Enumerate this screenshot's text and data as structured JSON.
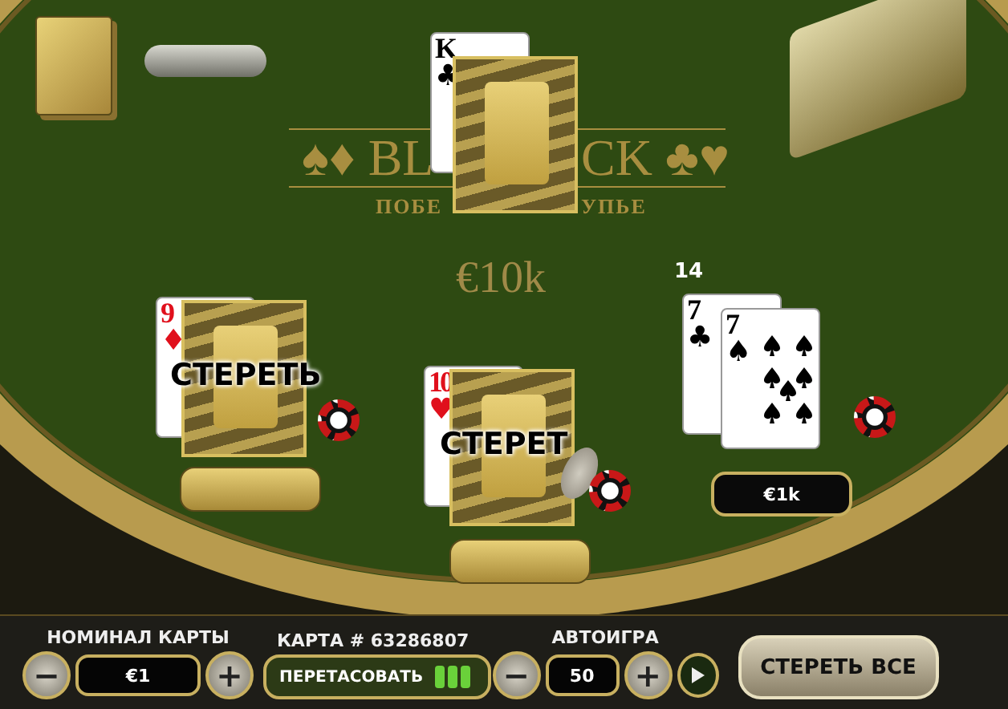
{
  "logo": {
    "left": "♠♦ BL",
    "right": "CK ♣♥",
    "sub_left": "ПОБЕ",
    "sub_right": "УПЬЕ"
  },
  "dealer": {
    "cards": [
      {
        "rank": "K",
        "suit": "♣",
        "color": "#000000"
      }
    ],
    "face_down": true
  },
  "pot": "€10k",
  "hands": [
    {
      "cards": [
        {
          "rank": "9",
          "suit": "♦",
          "color": "#e0101c"
        }
      ],
      "face_down": true,
      "label": "СТЕРЕТЬ",
      "coin": false
    },
    {
      "cards": [
        {
          "rank": "10",
          "suit": "♥",
          "color": "#e0101c"
        }
      ],
      "face_down": true,
      "label": "СТЕРЕТ",
      "coin": true
    },
    {
      "score": "14",
      "cards": [
        {
          "rank": "7",
          "suit": "♣",
          "color": "#000000"
        },
        {
          "rank": "7",
          "suit": "♠",
          "color": "#000000",
          "pips": true
        }
      ],
      "face_down": false,
      "bet": "€1k",
      "coin": false
    }
  ],
  "controls": {
    "card_value": {
      "label": "НОМИНАЛ КАРТЫ",
      "minus": "−",
      "value": "€1",
      "plus": "+"
    },
    "deck": {
      "label": "КАРТА # 63286807",
      "shuffle": "ПЕРЕТАСОВАТЬ"
    },
    "autoplay": {
      "label": "АВТОИГРА",
      "minus": "−",
      "value": "50",
      "plus": "+"
    },
    "clear_all": "СТЕРЕТЬ ВСЕ"
  }
}
